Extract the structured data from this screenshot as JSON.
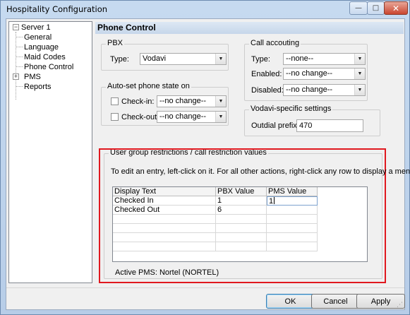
{
  "window": {
    "title": "Hospitality Configuration",
    "controls": {
      "minimize": "—",
      "maximize": "□",
      "close": "✕"
    }
  },
  "tree": {
    "items": [
      {
        "label": "Server 1",
        "expander": "−"
      },
      {
        "label": "General"
      },
      {
        "label": "Language"
      },
      {
        "label": "Maid Codes"
      },
      {
        "label": "Phone Control",
        "selected": true
      },
      {
        "label": "PMS",
        "expander": "+"
      },
      {
        "label": "Reports"
      }
    ]
  },
  "panel": {
    "title": "Phone Control",
    "pbx": {
      "legend": "PBX",
      "type_label": "Type:",
      "type_value": "Vodavi"
    },
    "call_accounting": {
      "legend": "Call accouting",
      "type_label": "Type:",
      "type_value": "--none--",
      "enabled_label": "Enabled:",
      "enabled_value": "--no change--",
      "disabled_label": "Disabled:",
      "disabled_value": "--no change--"
    },
    "auto_set": {
      "legend": "Auto-set phone state on",
      "checkin_label": "Check-in:",
      "checkin_value": "--no change--",
      "checkout_label": "Check-out:",
      "checkout_value": "--no change--"
    },
    "vodavi": {
      "legend": "Vodavi-specific settings",
      "outdial_label": "Outdial prefix:",
      "outdial_value": "470"
    },
    "restrictions": {
      "legend": "User group restrictions / call restriction values",
      "instructions": "To edit an entry, left-click on it.  For all other actions, right-click any row to display a menu.",
      "columns": [
        "Display Text",
        "PBX Value",
        "PMS Value"
      ],
      "rows": [
        [
          "Checked In",
          "1",
          "1"
        ],
        [
          "Checked Out",
          "6",
          ""
        ]
      ],
      "active_pms": "Active PMS:  Nortel (NORTEL)"
    }
  },
  "buttons": {
    "ok": "OK",
    "cancel": "Cancel",
    "apply": "Apply"
  },
  "colors": {
    "highlight": "#e0181f",
    "title_bar": "#c6daf0"
  }
}
